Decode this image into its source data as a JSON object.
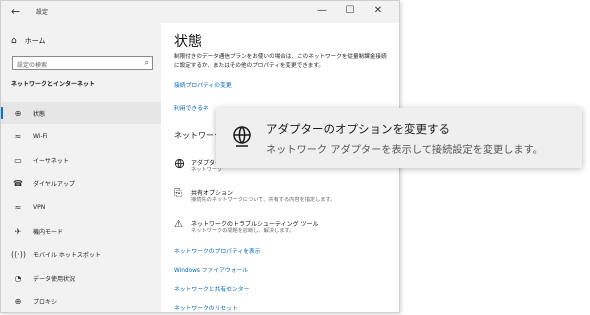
{
  "window": {
    "title": "設定",
    "back": "←",
    "minimize": "—",
    "maximize": "☐",
    "close": "✕"
  },
  "sidebar": {
    "home_label": "ホーム",
    "search_placeholder": "設定の検索",
    "section_title": "ネットワークとインターネット",
    "items": [
      {
        "label": "状態",
        "icon": "status-icon",
        "glyph": "⊕",
        "active": true
      },
      {
        "label": "Wi-Fi",
        "icon": "wifi-icon",
        "glyph": "≈",
        "active": false
      },
      {
        "label": "イーサネット",
        "icon": "ethernet-icon",
        "glyph": "▭",
        "active": false
      },
      {
        "label": "ダイヤルアップ",
        "icon": "dialup-icon",
        "glyph": "☎",
        "active": false
      },
      {
        "label": "VPN",
        "icon": "vpn-icon",
        "glyph": "≈",
        "active": false
      },
      {
        "label": "機内モード",
        "icon": "airplane-icon",
        "glyph": "✈",
        "active": false
      },
      {
        "label": "モバイル ホットスポット",
        "icon": "hotspot-icon",
        "glyph": "((·))",
        "active": false
      },
      {
        "label": "データ使用状況",
        "icon": "data-usage-icon",
        "glyph": "◔",
        "active": false
      },
      {
        "label": "プロキシ",
        "icon": "proxy-icon",
        "glyph": "⊕",
        "active": false
      }
    ]
  },
  "main": {
    "title": "状態",
    "description": "制限付きのデータ通信プランをお使いの場合は、このネットワークを従量制課金接続に設定するか、またはその他のプロパティを変更できます。",
    "change_properties_link": "接続プロパティの変更",
    "available_networks_link": "利用できるネ",
    "network_settings_heading": "ネットワーク",
    "items": [
      {
        "title": "アダプター",
        "desc": "ネットワーク",
        "icon": "adapter-icon",
        "glyph": "🌐"
      },
      {
        "title": "共有オプション",
        "desc": "接続先のネットワークについて、共有する内容を指定します。",
        "icon": "sharing-icon",
        "glyph": "⎘"
      },
      {
        "title": "ネットワークのトラブルシューティング ツール",
        "desc": "ネットワークの問題を診断し、解決します。",
        "icon": "troubleshoot-icon",
        "glyph": "⚠"
      }
    ],
    "links": [
      "ネットワークのプロパティを表示",
      "Windows ファイアウォール",
      "ネットワークと共有センター",
      "ネットワークのリセット"
    ]
  },
  "tooltip": {
    "title": "アダプターのオプションを変更する",
    "description": "ネットワーク アダプターを表示して接続設定を変更します。"
  },
  "colors": {
    "accent": "#0078d7",
    "link": "#0067b8"
  }
}
